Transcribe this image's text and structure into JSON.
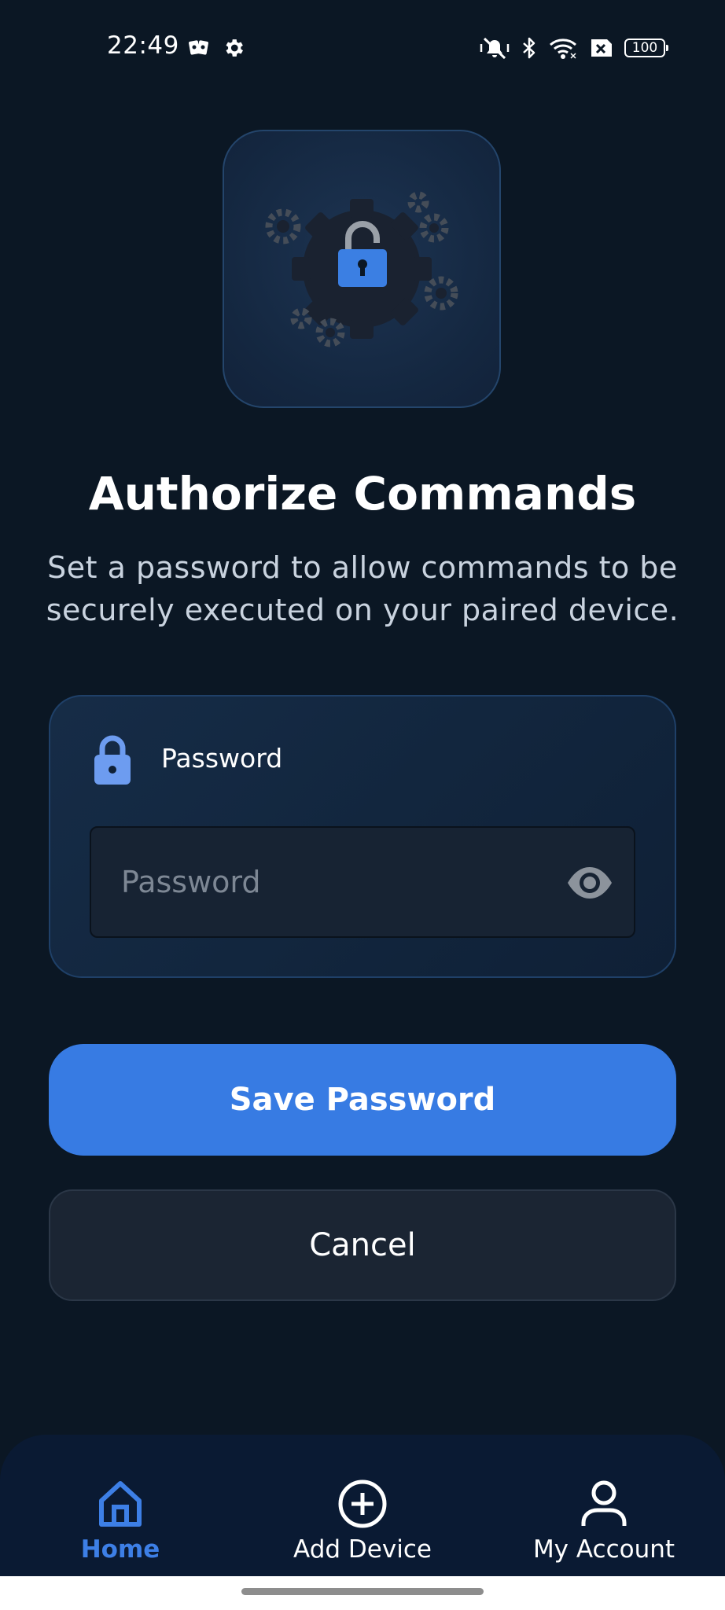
{
  "status_bar": {
    "time": "22:49",
    "battery": "100",
    "icons": [
      "cards-icon",
      "settings-gear-icon",
      "vibrate-off-icon",
      "bluetooth-icon",
      "wifi-icon",
      "no-sim-icon",
      "battery-icon"
    ]
  },
  "hero": {
    "icon": "gears-unlocked-padlock-icon",
    "title": "Authorize Commands",
    "subtitle": "Set a password to allow commands to be securely executed on your paired device."
  },
  "password_card": {
    "icon": "lock-icon",
    "label": "Password",
    "input_placeholder": "Password",
    "input_value": "",
    "toggle_icon": "eye-icon"
  },
  "actions": {
    "save_label": "Save Password",
    "cancel_label": "Cancel"
  },
  "bottom_nav": {
    "items": [
      {
        "label": "Home",
        "icon": "home-icon",
        "active": true
      },
      {
        "label": "Add Device",
        "icon": "add-circle-icon",
        "active": false
      },
      {
        "label": "My Account",
        "icon": "person-icon",
        "active": false
      }
    ]
  },
  "colors": {
    "background": "#0b1724",
    "accent": "#377be3",
    "card": "#142740",
    "nav_background": "#0a1a33"
  }
}
